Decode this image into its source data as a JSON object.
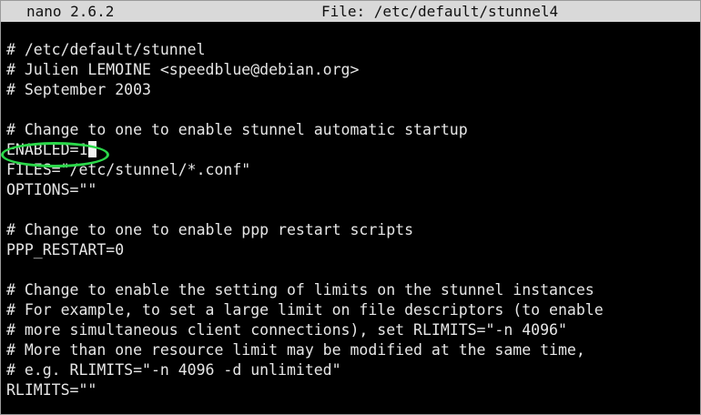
{
  "titlebar": {
    "app": "nano 2.6.2",
    "file": "File: /etc/default/stunnel4"
  },
  "editor": {
    "lines": [
      "# /etc/default/stunnel",
      "# Julien LEMOINE <speedblue@debian.org>",
      "# September 2003",
      "",
      "# Change to one to enable stunnel automatic startup",
      "ENABLED=1",
      "FILES=\"/etc/stunnel/*.conf\"",
      "OPTIONS=\"\"",
      "",
      "# Change to one to enable ppp restart scripts",
      "PPP_RESTART=0",
      "",
      "# Change to enable the setting of limits on the stunnel instances",
      "# For example, to set a large limit on file descriptors (to enable",
      "# more simultaneous client connections), set RLIMITS=\"-n 4096\"",
      "# More than one resource limit may be modified at the same time,",
      "# e.g. RLIMITS=\"-n 4096 -d unlimited\"",
      "RLIMITS=\"\""
    ]
  },
  "colors": {
    "terminal_bg": "#000000",
    "titlebar_bg": "#d9d9d9",
    "text": "#e6e6e6",
    "highlight_ring": "#2bd84a"
  }
}
